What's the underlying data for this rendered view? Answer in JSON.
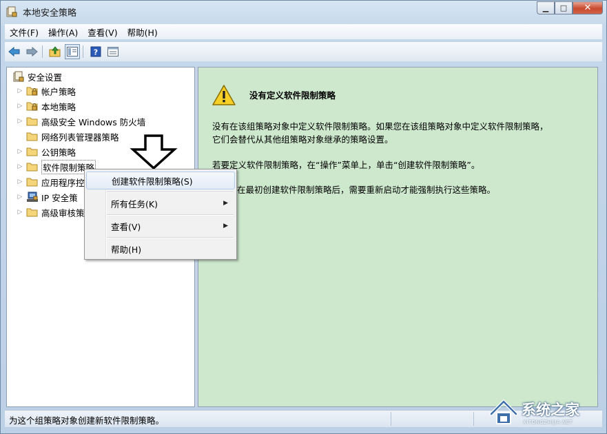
{
  "window": {
    "title": "本地安全策略",
    "caption": {
      "minimize": "▁",
      "maximize": "□",
      "close": "✕"
    }
  },
  "menubar": {
    "items": [
      "文件(F)",
      "操作(A)",
      "查看(V)",
      "帮助(H)"
    ]
  },
  "toolbar": {
    "icons": [
      "back-icon",
      "forward-icon",
      "up-folder-icon",
      "show-hide-tree-icon",
      "help-icon",
      "properties-icon"
    ]
  },
  "tree": {
    "root": "安全设置",
    "items": [
      {
        "label": "帐户策略",
        "icon": "locked-folder-icon",
        "expandable": true
      },
      {
        "label": "本地策略",
        "icon": "locked-folder-icon",
        "expandable": true
      },
      {
        "label": "高级安全 Windows 防火墙",
        "icon": "folder-icon",
        "expandable": true
      },
      {
        "label": "网络列表管理器策略",
        "icon": "folder-icon",
        "expandable": false
      },
      {
        "label": "公钥策略",
        "icon": "folder-icon",
        "expandable": true
      },
      {
        "label": "软件限制策略",
        "icon": "folder-icon",
        "expandable": true,
        "selected": true
      },
      {
        "label": "应用程序控",
        "icon": "folder-icon",
        "expandable": true
      },
      {
        "label": "IP 安全策",
        "icon": "ip-security-icon",
        "expandable": true
      },
      {
        "label": "高级审核策",
        "icon": "folder-icon",
        "expandable": true
      }
    ]
  },
  "content": {
    "heading": "没有定义软件限制策略",
    "para1": "没有在该组策略对象中定义软件限制策略。如果您在该组策略对象中定义软件限制策略，",
    "para1b": "它们会替代从其他组策略对象继承的策略设置。",
    "para2": "若要定义软件限制策略，在“操作”菜单上，单击“创建软件限制策略”。",
    "para3": "在最初创建软件限制策略后，需要重新启动才能强制执行这些策略。"
  },
  "context_menu": {
    "items": [
      {
        "label": "创建软件限制策略(S)",
        "submenu": false,
        "hover": true
      },
      {
        "label": "所有任务(K)",
        "submenu": true
      },
      {
        "label": "查看(V)",
        "submenu": true
      },
      {
        "label": "帮助(H)",
        "submenu": false
      }
    ],
    "submenu_glyph": "▶"
  },
  "statusbar": {
    "text": "为这个组策略对象创建新软件限制策略。"
  },
  "watermark": {
    "brand": "系统之家",
    "url": "XITONGZHIJIA.NET"
  },
  "colors": {
    "content_bg": "#cde8cd",
    "window_frame": "#c4d7ea"
  }
}
